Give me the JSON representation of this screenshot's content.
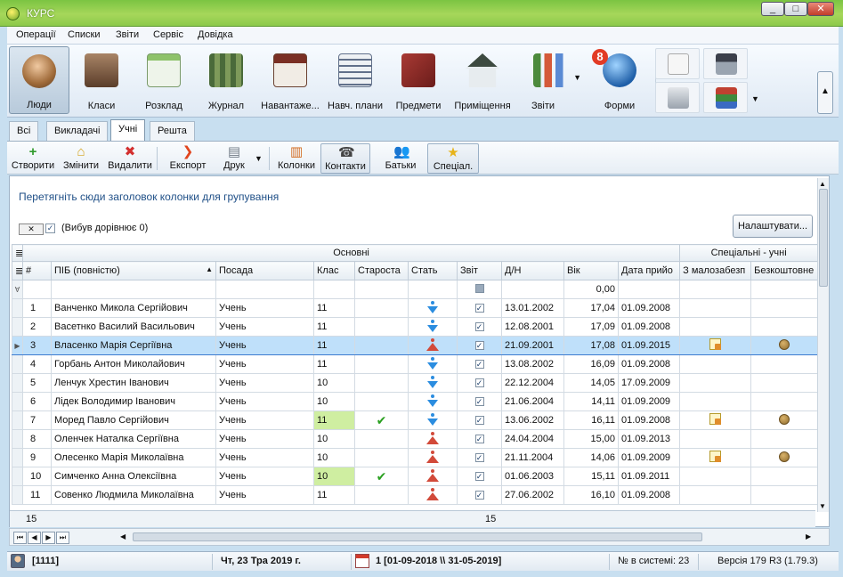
{
  "window": {
    "title": "КУРС",
    "min": "_",
    "max": "□",
    "close": "✕"
  },
  "menu": [
    "Операції",
    "Списки",
    "Звіти",
    "Сервіс",
    "Довідка"
  ],
  "ribbon": {
    "buttons": [
      "Люди",
      "Класи",
      "Розклад",
      "Журнал",
      "Навантаже...",
      "Навч. плани",
      "Предмети",
      "Приміщення",
      "Звіти",
      "Форми"
    ],
    "forms_badge": "8",
    "collapse": "▲"
  },
  "tabs": [
    "Всі",
    "Викладачі",
    "Учні",
    "Решта"
  ],
  "toolbar": {
    "create": "Створити",
    "edit": "Змінити",
    "delete": "Видалити",
    "export": "Експорт",
    "print": "Друк",
    "columns": "Колонки",
    "contacts": "Контакти",
    "parents": "Батьки",
    "special": "Спеціал."
  },
  "grid": {
    "group_hint": "Перетягніть сюди заголовок колонки для групування",
    "filter_text": "(Вибув дорівнює 0)",
    "settings_button": "Налаштувати...",
    "band_main": "Основні",
    "band_special": "Спеціальні - учні",
    "columns": [
      "#",
      "ПІБ (повністю)",
      "Посада",
      "Клас",
      "Староста",
      "Стать",
      "Звіт",
      "Д/Н",
      "Вік",
      "Дата прийо",
      "З малозабезп",
      "Безкоштовне"
    ],
    "filter_age": "0,00",
    "rows": [
      {
        "n": "1",
        "name": "Ванченко Микола Сергійович",
        "pos": "Учень",
        "cls": "11",
        "head": false,
        "sex": "m",
        "rep": true,
        "dob": "13.01.2002",
        "age": "17,04",
        "date": "01.09.2008",
        "low": false,
        "free": false
      },
      {
        "n": "2",
        "name": "Васетнко Василий Васильович",
        "pos": "Учень",
        "cls": "11",
        "head": false,
        "sex": "m",
        "rep": true,
        "dob": "12.08.2001",
        "age": "17,09",
        "date": "01.09.2008",
        "low": false,
        "free": false
      },
      {
        "n": "3",
        "name": "Власенко Марія Сергіївна",
        "pos": "Учень",
        "cls": "11",
        "head": false,
        "sex": "f",
        "rep": true,
        "dob": "21.09.2001",
        "age": "17,08",
        "date": "01.09.2015",
        "low": true,
        "free": true
      },
      {
        "n": "4",
        "name": "Горбань Антон Миколайович",
        "pos": "Учень",
        "cls": "11",
        "head": false,
        "sex": "m",
        "rep": true,
        "dob": "13.08.2002",
        "age": "16,09",
        "date": "01.09.2008",
        "low": false,
        "free": false
      },
      {
        "n": "5",
        "name": "Ленчук Хрестин Іванович",
        "pos": "Учень",
        "cls": "10",
        "head": false,
        "sex": "m",
        "rep": true,
        "dob": "22.12.2004",
        "age": "14,05",
        "date": "17.09.2009",
        "low": false,
        "free": false
      },
      {
        "n": "6",
        "name": "Лідек Володимир Іванович",
        "pos": "Учень",
        "cls": "10",
        "head": false,
        "sex": "m",
        "rep": true,
        "dob": "21.06.2004",
        "age": "14,11",
        "date": "01.09.2009",
        "low": false,
        "free": false
      },
      {
        "n": "7",
        "name": "Моред Павло Сергійович",
        "pos": "Учень",
        "cls": "11",
        "head": true,
        "sex": "m",
        "rep": true,
        "dob": "13.06.2002",
        "age": "16,11",
        "date": "01.09.2008",
        "low": true,
        "free": true
      },
      {
        "n": "8",
        "name": "Оленчек Наталка Сергіївна",
        "pos": "Учень",
        "cls": "10",
        "head": false,
        "sex": "f",
        "rep": true,
        "dob": "24.04.2004",
        "age": "15,00",
        "date": "01.09.2013",
        "low": false,
        "free": false
      },
      {
        "n": "9",
        "name": "Олесенко Марія Миколаївна",
        "pos": "Учень",
        "cls": "10",
        "head": false,
        "sex": "f",
        "rep": true,
        "dob": "21.11.2004",
        "age": "14,06",
        "date": "01.09.2009",
        "low": true,
        "free": true
      },
      {
        "n": "10",
        "name": "Симченко Анна Олексіївна",
        "pos": "Учень",
        "cls": "10",
        "head": true,
        "sex": "f",
        "rep": true,
        "dob": "01.06.2003",
        "age": "15,11",
        "date": "01.09.2011",
        "low": false,
        "free": false
      },
      {
        "n": "11",
        "name": "Совенко Людмила Миколаївна",
        "pos": "Учень",
        "cls": "11",
        "head": false,
        "sex": "f",
        "rep": true,
        "dob": "27.06.2002",
        "age": "16,10",
        "date": "01.09.2008",
        "low": false,
        "free": false
      }
    ],
    "selected_row": 2,
    "footer_count": "15",
    "footer_count2": "15"
  },
  "status": {
    "user": "[1111]",
    "date": "Чт, 23 Тра 2019 г.",
    "period": "1 [01-09-2018 \\\\ 31-05-2019]",
    "system_no": "№ в системі: 23",
    "version": "Версія 179 R3 (1.79.3)"
  }
}
